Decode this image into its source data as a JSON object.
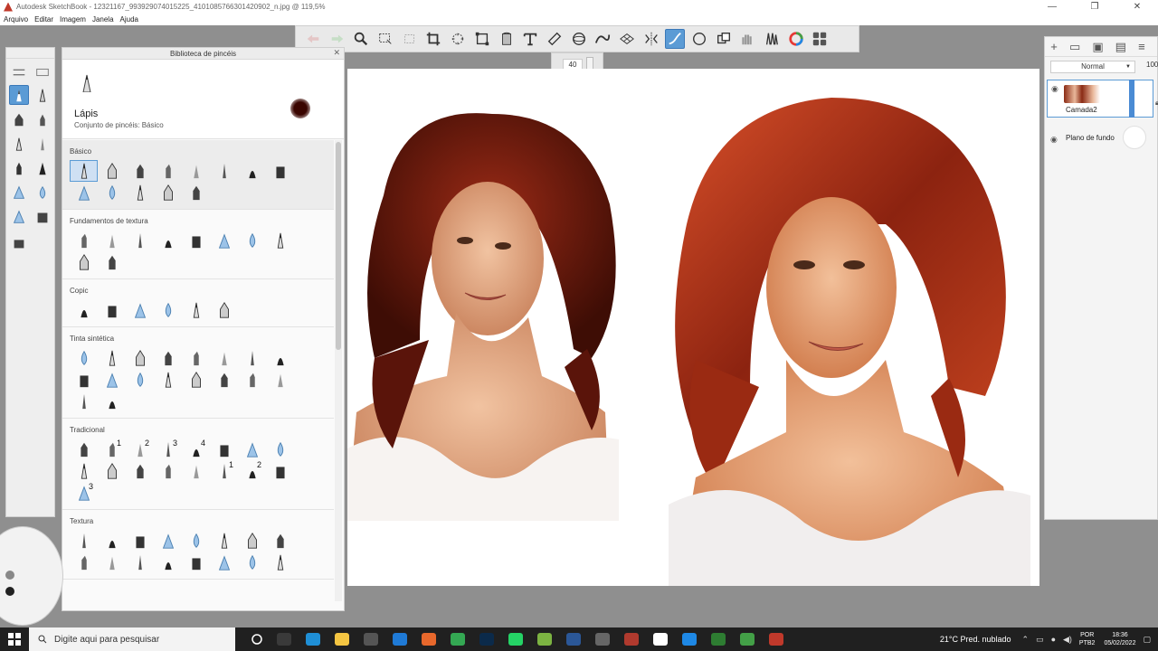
{
  "window": {
    "title": "Autodesk SketchBook - 12321167_993929074015225_4101085766301420902_n.jpg @ 119,5%",
    "minimize": "—",
    "maximize": "❐",
    "close": "✕"
  },
  "menu": [
    "Arquivo",
    "Editar",
    "Imagem",
    "Janela",
    "Ajuda"
  ],
  "toolbar": {
    "tools": [
      "undo-icon",
      "redo-icon",
      "zoom-icon",
      "select-icon",
      "transform-icon",
      "crop-icon",
      "lasso-icon",
      "perspective-icon",
      "bucket-icon",
      "text-icon",
      "ruler-icon",
      "ellipse-guide-icon",
      "curve-ruler-icon",
      "perspective-grid-icon",
      "symmetry-icon",
      "stroke-icon",
      "shape-icon",
      "copy-icon",
      "hand-icon",
      "brush-set-icon",
      "color-wheel-icon",
      "palette-icon"
    ],
    "active": "stroke-icon"
  },
  "size_popup": {
    "value": "40"
  },
  "brush_library": {
    "title": "Biblioteca de pincéis",
    "close": "✕",
    "selected_name": "Lápis",
    "selected_set": "Conjunto de pincéis: Básico",
    "sections": [
      {
        "title": "Básico",
        "count": 13
      },
      {
        "title": "Fundamentos de textura",
        "count": 10
      },
      {
        "title": "Copic",
        "count": 6
      },
      {
        "title": "Tinta sintética",
        "count": 18
      },
      {
        "title": "Tradicional",
        "count": 17
      },
      {
        "title": "Textura",
        "count": 16
      }
    ],
    "tradicional_numbers": [
      "1",
      "2",
      "3",
      "4",
      "1",
      "2",
      "3"
    ]
  },
  "layers": {
    "blend_mode": "Normal",
    "opacity": "100",
    "items": [
      {
        "name": "Camada2"
      },
      {
        "name": "Plano de fundo"
      }
    ]
  },
  "taskbar": {
    "search_placeholder": "Digite aqui para pesquisar",
    "weather": "21°C  Pred. nublado",
    "lang": "POR",
    "lang2": "PTB2",
    "time": "18:36",
    "date": "05/02/2022",
    "apps": [
      {
        "name": "task-view",
        "color": "#3a3a3a"
      },
      {
        "name": "edge",
        "color": "#1f8fd6"
      },
      {
        "name": "explorer",
        "color": "#f4c542"
      },
      {
        "name": "store",
        "color": "#555555"
      },
      {
        "name": "mail",
        "color": "#1f7ad6"
      },
      {
        "name": "firefox",
        "color": "#e8682c"
      },
      {
        "name": "chrome",
        "color": "#34a853"
      },
      {
        "name": "photoshop",
        "color": "#0b2a4a"
      },
      {
        "name": "whatsapp",
        "color": "#25d366"
      },
      {
        "name": "sketchbook-green",
        "color": "#7cb342"
      },
      {
        "name": "word",
        "color": "#2b5797"
      },
      {
        "name": "pen",
        "color": "#666666"
      },
      {
        "name": "app-red",
        "color": "#b03a2e"
      },
      {
        "name": "app-w",
        "color": "#ffffff"
      },
      {
        "name": "app-blue",
        "color": "#1e88e5"
      },
      {
        "name": "app-green",
        "color": "#2e7d32"
      },
      {
        "name": "app-green2",
        "color": "#43a047"
      },
      {
        "name": "sketchbook",
        "color": "#c0392b"
      }
    ]
  }
}
